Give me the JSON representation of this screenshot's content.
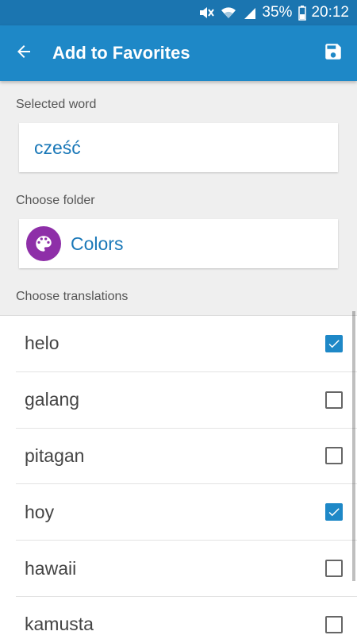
{
  "status_bar": {
    "battery": "35%",
    "time": "20:12",
    "icons": [
      "mute-icon",
      "wifi-icon",
      "signal-icon",
      "battery-icon"
    ]
  },
  "app_bar": {
    "title": "Add to Favorites",
    "back_icon": "arrow-back-icon",
    "save_icon": "save-icon",
    "color": "#1e88c7"
  },
  "selected_word": {
    "label": "Selected word",
    "value": "cześć"
  },
  "folder": {
    "label": "Choose folder",
    "name": "Colors",
    "icon": "palette-icon",
    "icon_color": "#8e2fa8"
  },
  "translations": {
    "label": "Choose translations",
    "items": [
      {
        "text": "helo",
        "checked": true
      },
      {
        "text": "galang",
        "checked": false
      },
      {
        "text": "pitagan",
        "checked": false
      },
      {
        "text": "hoy",
        "checked": true
      },
      {
        "text": "hawaii",
        "checked": false
      },
      {
        "text": "kamusta",
        "checked": false
      }
    ]
  }
}
